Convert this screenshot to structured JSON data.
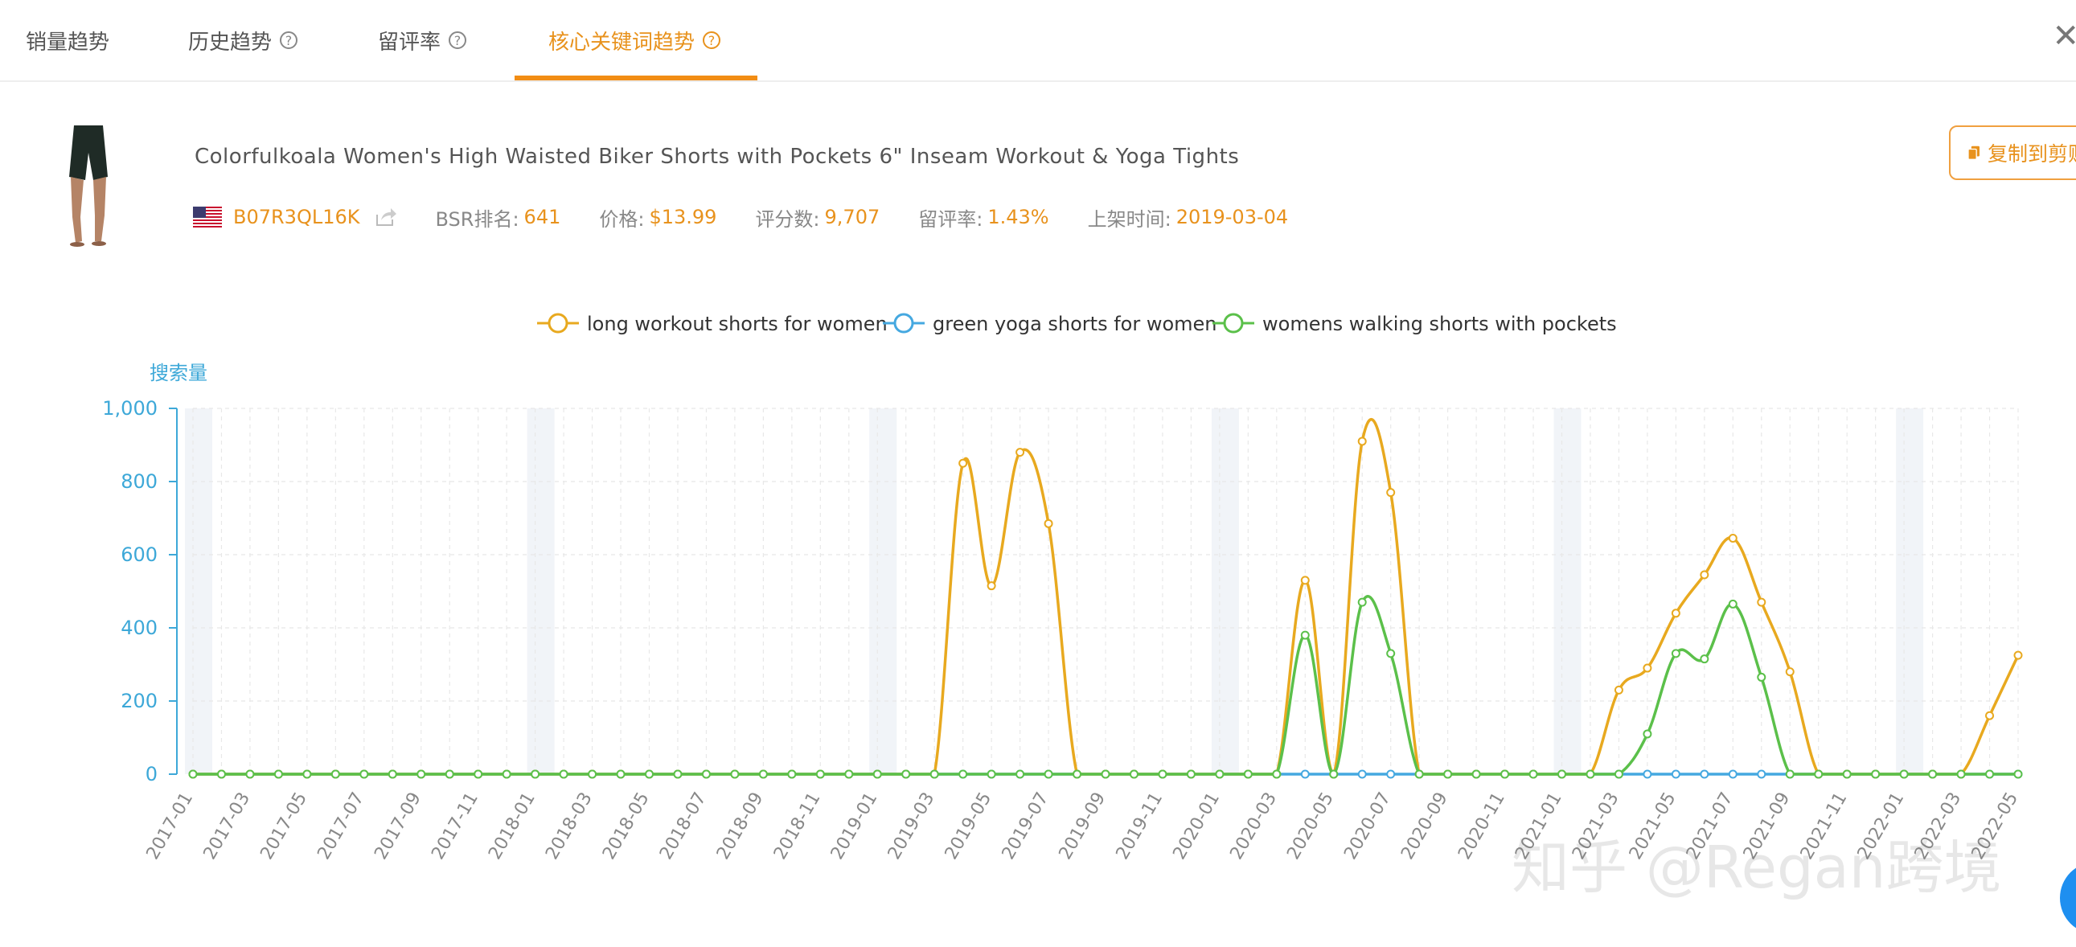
{
  "tabs": [
    {
      "label": "销量趋势",
      "help": false,
      "active": false
    },
    {
      "label": "历史趋势",
      "help": true,
      "active": false
    },
    {
      "label": "留评率",
      "help": true,
      "active": false
    },
    {
      "label": "核心关键词趋势",
      "help": true,
      "active": true
    }
  ],
  "help_glyph": "?",
  "close_glyph": "✕",
  "product": {
    "title": "Colorfulkoala Women's High Waisted Biker Shorts with Pockets 6\" Inseam Workout & Yoga Tights",
    "asin": "B07R3QL16K",
    "bsr_label": "BSR排名:",
    "bsr_value": "641",
    "price_label": "价格:",
    "price_value": "$13.99",
    "ratings_label": "评分数:",
    "ratings_value": "9,707",
    "review_rate_label": "留评率:",
    "review_rate_value": "1.43%",
    "listed_label": "上架时间:",
    "listed_value": "2019-03-04",
    "copy_button": "复制到剪贴板"
  },
  "colors": {
    "accent": "#e8921d",
    "series1": "#e8a91f",
    "series2": "#45a8e0",
    "series3": "#5bc04a",
    "axis": "#3da8d8"
  },
  "watermark": "知乎 @Regan跨境",
  "chart_data": {
    "type": "line",
    "ylabel": "搜索量",
    "ylim": [
      0,
      1000
    ],
    "yticks": [
      "0",
      "200",
      "400",
      "600",
      "800",
      "1,000"
    ],
    "x": [
      "2017-01",
      "2017-02",
      "2017-03",
      "2017-04",
      "2017-05",
      "2017-06",
      "2017-07",
      "2017-08",
      "2017-09",
      "2017-10",
      "2017-11",
      "2017-12",
      "2018-01",
      "2018-02",
      "2018-03",
      "2018-04",
      "2018-05",
      "2018-06",
      "2018-07",
      "2018-08",
      "2018-09",
      "2018-10",
      "2018-11",
      "2018-12",
      "2019-01",
      "2019-02",
      "2019-03",
      "2019-04",
      "2019-05",
      "2019-06",
      "2019-07",
      "2019-08",
      "2019-09",
      "2019-10",
      "2019-11",
      "2019-12",
      "2020-01",
      "2020-02",
      "2020-03",
      "2020-04",
      "2020-05",
      "2020-06",
      "2020-07",
      "2020-08",
      "2020-09",
      "2020-10",
      "2020-11",
      "2020-12",
      "2021-01",
      "2021-02",
      "2021-03",
      "2021-04",
      "2021-05",
      "2021-06",
      "2021-07",
      "2021-08",
      "2021-09",
      "2021-10",
      "2021-11",
      "2021-12",
      "2022-01",
      "2022-02",
      "2022-03",
      "2022-04",
      "2022-05"
    ],
    "xtick_labels": [
      "2017-01",
      "2017-03",
      "2017-05",
      "2017-07",
      "2017-09",
      "2017-11",
      "2018-01",
      "2018-03",
      "2018-05",
      "2018-07",
      "2018-09",
      "2018-11",
      "2019-01",
      "2019-03",
      "2019-05",
      "2019-07",
      "2019-09",
      "2019-11",
      "2020-01",
      "2020-03",
      "2020-05",
      "2020-07",
      "2020-09",
      "2020-11",
      "2021-01",
      "2021-03",
      "2021-05",
      "2021-07",
      "2021-09",
      "2021-11",
      "2022-01",
      "2022-03",
      "2022-05"
    ],
    "series": [
      {
        "name": "long workout shorts for women",
        "color": "#e8a91f",
        "values": [
          0,
          0,
          0,
          0,
          0,
          0,
          0,
          0,
          0,
          0,
          0,
          0,
          0,
          0,
          0,
          0,
          0,
          0,
          0,
          0,
          0,
          0,
          0,
          0,
          0,
          0,
          0,
          850,
          515,
          880,
          685,
          0,
          0,
          0,
          0,
          0,
          0,
          0,
          0,
          530,
          0,
          910,
          770,
          0,
          0,
          0,
          0,
          0,
          0,
          0,
          230,
          290,
          440,
          545,
          645,
          470,
          280,
          0,
          0,
          0,
          0,
          0,
          0,
          160,
          325
        ]
      },
      {
        "name": "green yoga shorts for women",
        "color": "#45a8e0",
        "values": [
          0,
          0,
          0,
          0,
          0,
          0,
          0,
          0,
          0,
          0,
          0,
          0,
          0,
          0,
          0,
          0,
          0,
          0,
          0,
          0,
          0,
          0,
          0,
          0,
          0,
          0,
          0,
          0,
          0,
          0,
          0,
          0,
          0,
          0,
          0,
          0,
          0,
          0,
          0,
          0,
          0,
          0,
          0,
          0,
          0,
          0,
          0,
          0,
          0,
          0,
          0,
          0,
          0,
          0,
          0,
          0,
          0,
          0,
          0,
          0,
          0,
          0,
          0,
          0,
          0
        ]
      },
      {
        "name": "womens walking shorts with pockets",
        "color": "#5bc04a",
        "values": [
          0,
          0,
          0,
          0,
          0,
          0,
          0,
          0,
          0,
          0,
          0,
          0,
          0,
          0,
          0,
          0,
          0,
          0,
          0,
          0,
          0,
          0,
          0,
          0,
          0,
          0,
          0,
          0,
          0,
          0,
          0,
          0,
          0,
          0,
          0,
          0,
          0,
          0,
          0,
          380,
          0,
          470,
          330,
          0,
          0,
          0,
          0,
          0,
          0,
          0,
          0,
          110,
          330,
          315,
          465,
          265,
          0,
          0,
          0,
          0,
          0,
          0,
          0,
          0,
          0
        ]
      }
    ],
    "legend_position": "top-center",
    "grid": true
  }
}
